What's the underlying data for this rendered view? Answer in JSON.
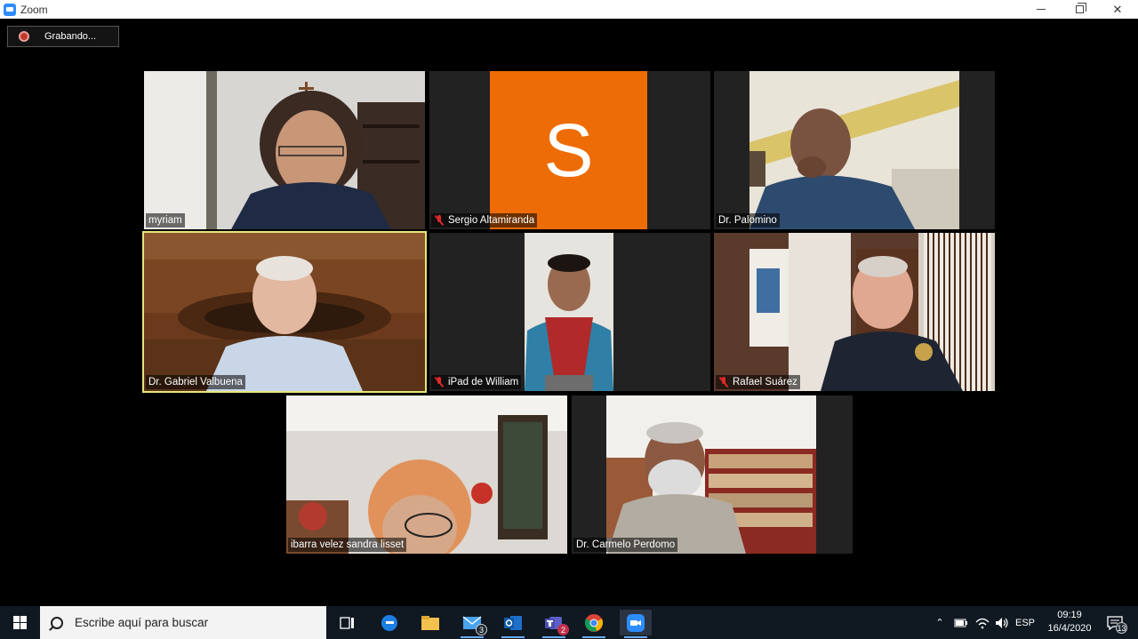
{
  "window": {
    "title": "Zoom",
    "recording_label": "Grabando..."
  },
  "participants": [
    {
      "name": "myriam",
      "muted": false,
      "active": false
    },
    {
      "name": "Sergio Altamiranda",
      "muted": true,
      "active": false,
      "avatar_letter": "S",
      "avatar_color": "#EE6C06"
    },
    {
      "name": "Dr. Palomino",
      "muted": false,
      "active": false
    },
    {
      "name": "Dr. Gabriel Valbuena",
      "muted": false,
      "active": true
    },
    {
      "name": "iPad de William",
      "muted": true,
      "active": false
    },
    {
      "name": "Rafael Suárez",
      "muted": true,
      "active": false
    },
    {
      "name": "ibarra velez sandra lisset",
      "muted": false,
      "active": false
    },
    {
      "name": "Dr. Carmelo Perdomo",
      "muted": false,
      "active": false
    }
  ],
  "taskbar": {
    "search_placeholder": "Escribe aquí para buscar",
    "mail_badge": "3",
    "teams_badge": "2",
    "language": "ESP",
    "time": "09:19",
    "date": "16/4/2020",
    "notifications_badge": "13"
  },
  "colors": {
    "active_speaker_border": "#E6E67A",
    "zoom_blue": "#2D8CFF",
    "muted_red": "#E02828",
    "taskbar_bg": "#101822"
  }
}
